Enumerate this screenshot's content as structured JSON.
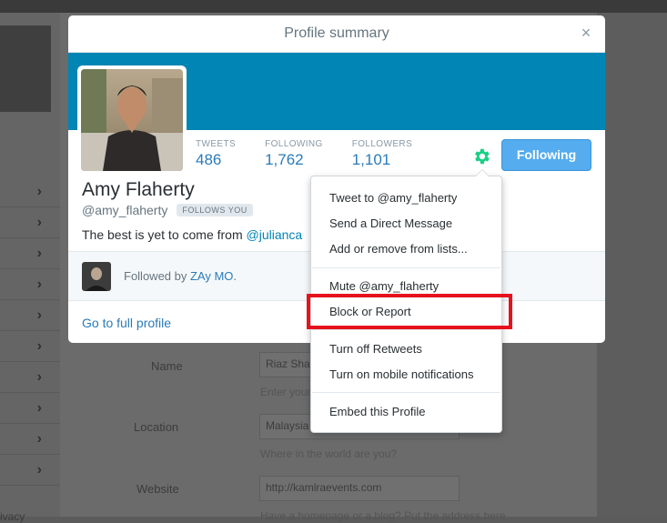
{
  "modal": {
    "title": "Profile summary",
    "close_label": "×"
  },
  "profile": {
    "name": "Amy Flaherty",
    "handle": "@amy_flaherty",
    "follows_badge": "FOLLOWS YOU",
    "bio_text": "The best is yet to come from ",
    "bio_mention": "@julianca",
    "stats": [
      {
        "label": "TWEETS",
        "value": "486"
      },
      {
        "label": "FOLLOWING",
        "value": "1,762"
      },
      {
        "label": "FOLLOWERS",
        "value": "1,101"
      }
    ],
    "follow_button": "Following",
    "followed_by_prefix": "Followed by ",
    "followed_by_name": "ZAy MO",
    "followed_by_suffix": ".",
    "full_profile_link": "Go to full profile"
  },
  "dropdown": {
    "items": [
      "Tweet to @amy_flaherty",
      "Send a Direct Message",
      "Add or remove from lists...",
      "Mute @amy_flaherty",
      "Block or Report",
      "Turn off Retweets",
      "Turn on mobile notifications",
      "Embed this Profile"
    ]
  },
  "background_form": {
    "name_label": "Name",
    "name_value": "Riaz Shah",
    "name_hint": "Enter your real name",
    "location_label": "Location",
    "location_value": "Malaysia",
    "location_hint": "Where in the world are you?",
    "website_label": "Website",
    "website_value": "http://kamlraevents.com",
    "website_hint": "Have a homepage or a blog? Put the address here",
    "privacy_text": "ivacy"
  },
  "colors": {
    "banner": "#0085b4",
    "accent": "#2b7bb9",
    "follow_button": "#55acee",
    "gear": "#19cf86",
    "highlight": "#e5121d"
  }
}
